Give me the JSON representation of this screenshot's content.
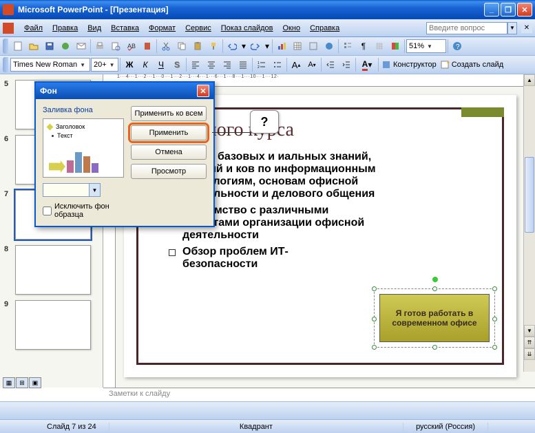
{
  "app": {
    "title": "Microsoft PowerPoint - [Презентация]"
  },
  "menu": {
    "file": "Файл",
    "edit": "Правка",
    "view": "Вид",
    "insert": "Вставка",
    "format": "Формат",
    "tools": "Сервис",
    "slideshow": "Показ слайдов",
    "window": "Окно",
    "help": "Справка",
    "help_placeholder": "Введите вопрос"
  },
  "toolbar": {
    "font_name": "Times New Roman",
    "font_size": "20+",
    "zoom": "51%",
    "designer": "Конструктор",
    "new_slide": "Создать слайд"
  },
  "ruler_h": "1···4···1···2···1···0···1···2···1···4···1···6···1···8···1···10···1···12·",
  "dialog": {
    "title": "Фон",
    "group_label": "Заливка фона",
    "preview_title": "Заголовок",
    "preview_text": "Текст",
    "chk_label": "Исключить фон образца",
    "btn_apply_all": "Применить ко всем",
    "btn_apply": "Применить",
    "btn_cancel": "Отмена",
    "btn_preview": "Просмотр"
  },
  "tooltip": "?",
  "slide": {
    "title_partial": "и учебного курса",
    "bullets": [
      "чение базовых и\nиальных знаний, умений и\nков по информационным\nтехнологиям, основам офисной деятельности и делового общения",
      "Знакомство с различными аспектами организации офисной деятельности",
      "Обзор проблем ИТ-безопасности"
    ],
    "callout": "Я готов работать в современном офисе"
  },
  "thumbs": {
    "n5": "5",
    "n6": "6",
    "n7": "7",
    "n8": "8",
    "n9": "9"
  },
  "notes": "Заметки к слайду",
  "status": {
    "slide": "Слайд 7 из 24",
    "template": "Квадрант",
    "lang": "русский (Россия)"
  }
}
